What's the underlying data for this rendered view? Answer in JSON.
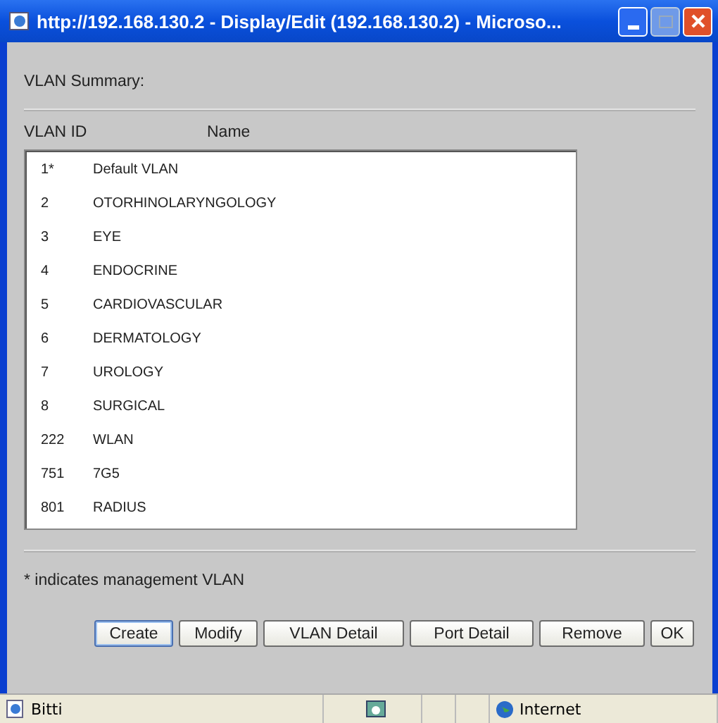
{
  "window": {
    "title": "http://192.168.130.2 - Display/Edit (192.168.130.2) - Microso..."
  },
  "heading": "VLAN Summary:",
  "table": {
    "columns": [
      "VLAN ID",
      "Name"
    ],
    "rows": [
      {
        "id": "1*",
        "name": "Default VLAN"
      },
      {
        "id": "2",
        "name": "OTORHINOLARYNGOLOGY"
      },
      {
        "id": "3",
        "name": "EYE"
      },
      {
        "id": "4",
        "name": "ENDOCRINE"
      },
      {
        "id": "5",
        "name": "CARDIOVASCULAR"
      },
      {
        "id": "6",
        "name": "DERMATOLOGY"
      },
      {
        "id": "7",
        "name": "UROLOGY"
      },
      {
        "id": "8",
        "name": "SURGICAL"
      },
      {
        "id": "222",
        "name": "WLAN"
      },
      {
        "id": "751",
        "name": "7G5"
      },
      {
        "id": "801",
        "name": "RADIUS"
      }
    ]
  },
  "note": "* indicates management VLAN",
  "buttons": [
    {
      "label": "Create",
      "focused": true
    },
    {
      "label": "Modify",
      "focused": false
    },
    {
      "label": "VLAN Detail",
      "focused": false
    },
    {
      "label": "Port Detail",
      "focused": false
    },
    {
      "label": "Remove",
      "focused": false
    },
    {
      "label": "OK",
      "focused": false
    }
  ],
  "status_bar": {
    "status": "Bitti",
    "zone": "Internet"
  }
}
